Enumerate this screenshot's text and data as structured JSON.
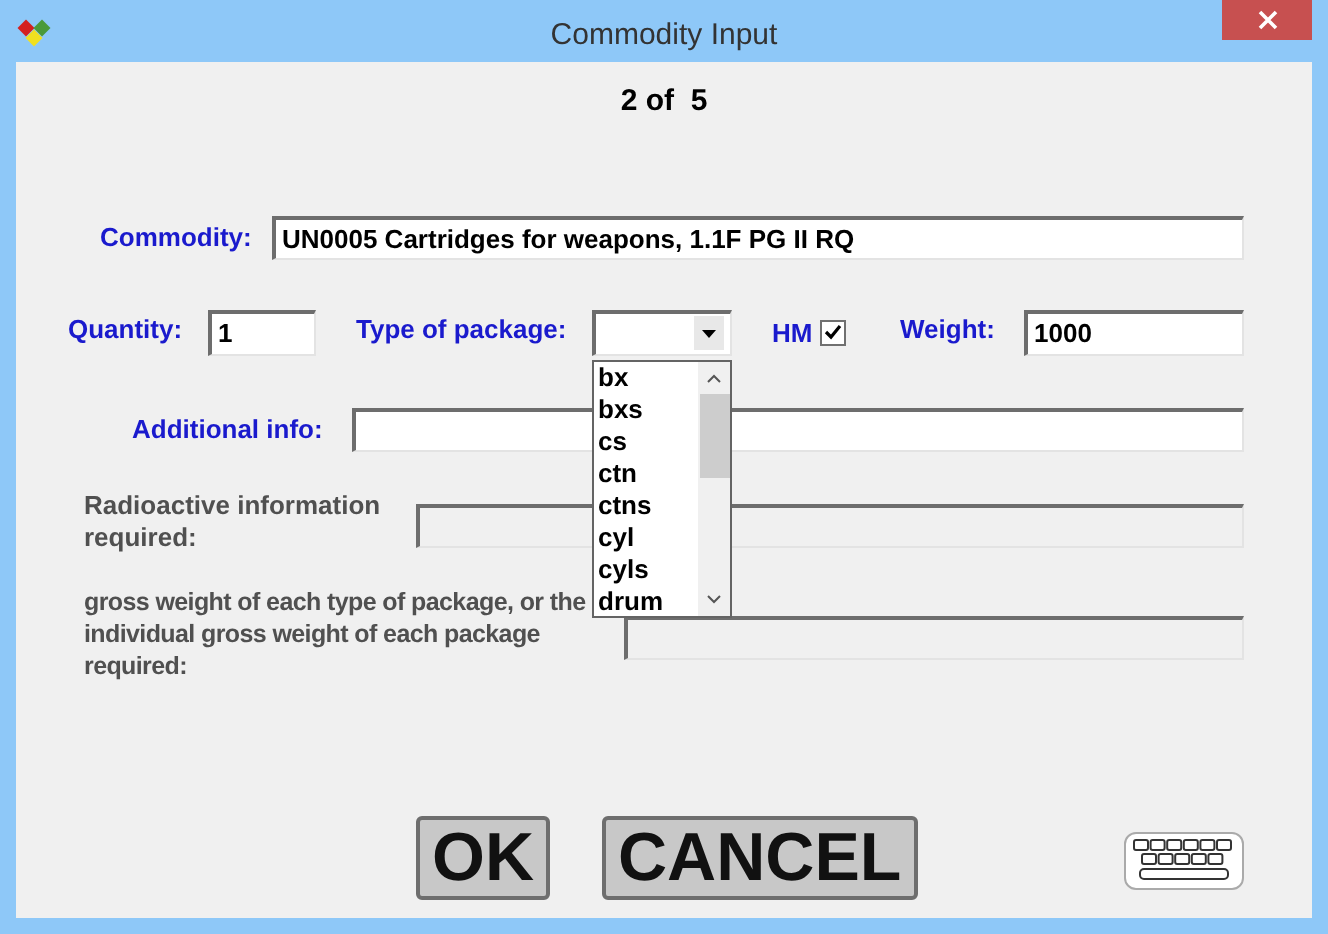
{
  "window": {
    "title": "Commodity Input"
  },
  "counter": "2 of  5",
  "commodity": {
    "label": "Commodity:",
    "value": "UN0005 Cartridges for weapons, 1.1F PG II RQ"
  },
  "quantity": {
    "label": "Quantity:",
    "value": "1"
  },
  "type_of_package": {
    "label": "Type of package:",
    "expanded": true,
    "options": [
      "bx",
      "bxs",
      "cs",
      "ctn",
      "ctns",
      "cyl",
      "cyls",
      "drum"
    ]
  },
  "hm": {
    "label": "HM",
    "checked": true
  },
  "weight": {
    "label": "Weight:",
    "value": "1000"
  },
  "additional_info": {
    "label": "Additional info:"
  },
  "radioactive": {
    "label": "Radioactive information required:",
    "disabled": true
  },
  "gross_weight": {
    "label": "gross weight of each type of package, or the individual gross weight of each package required:",
    "disabled": true
  },
  "buttons": [
    {
      "label": "OK"
    },
    {
      "label": "CANCEL"
    }
  ]
}
